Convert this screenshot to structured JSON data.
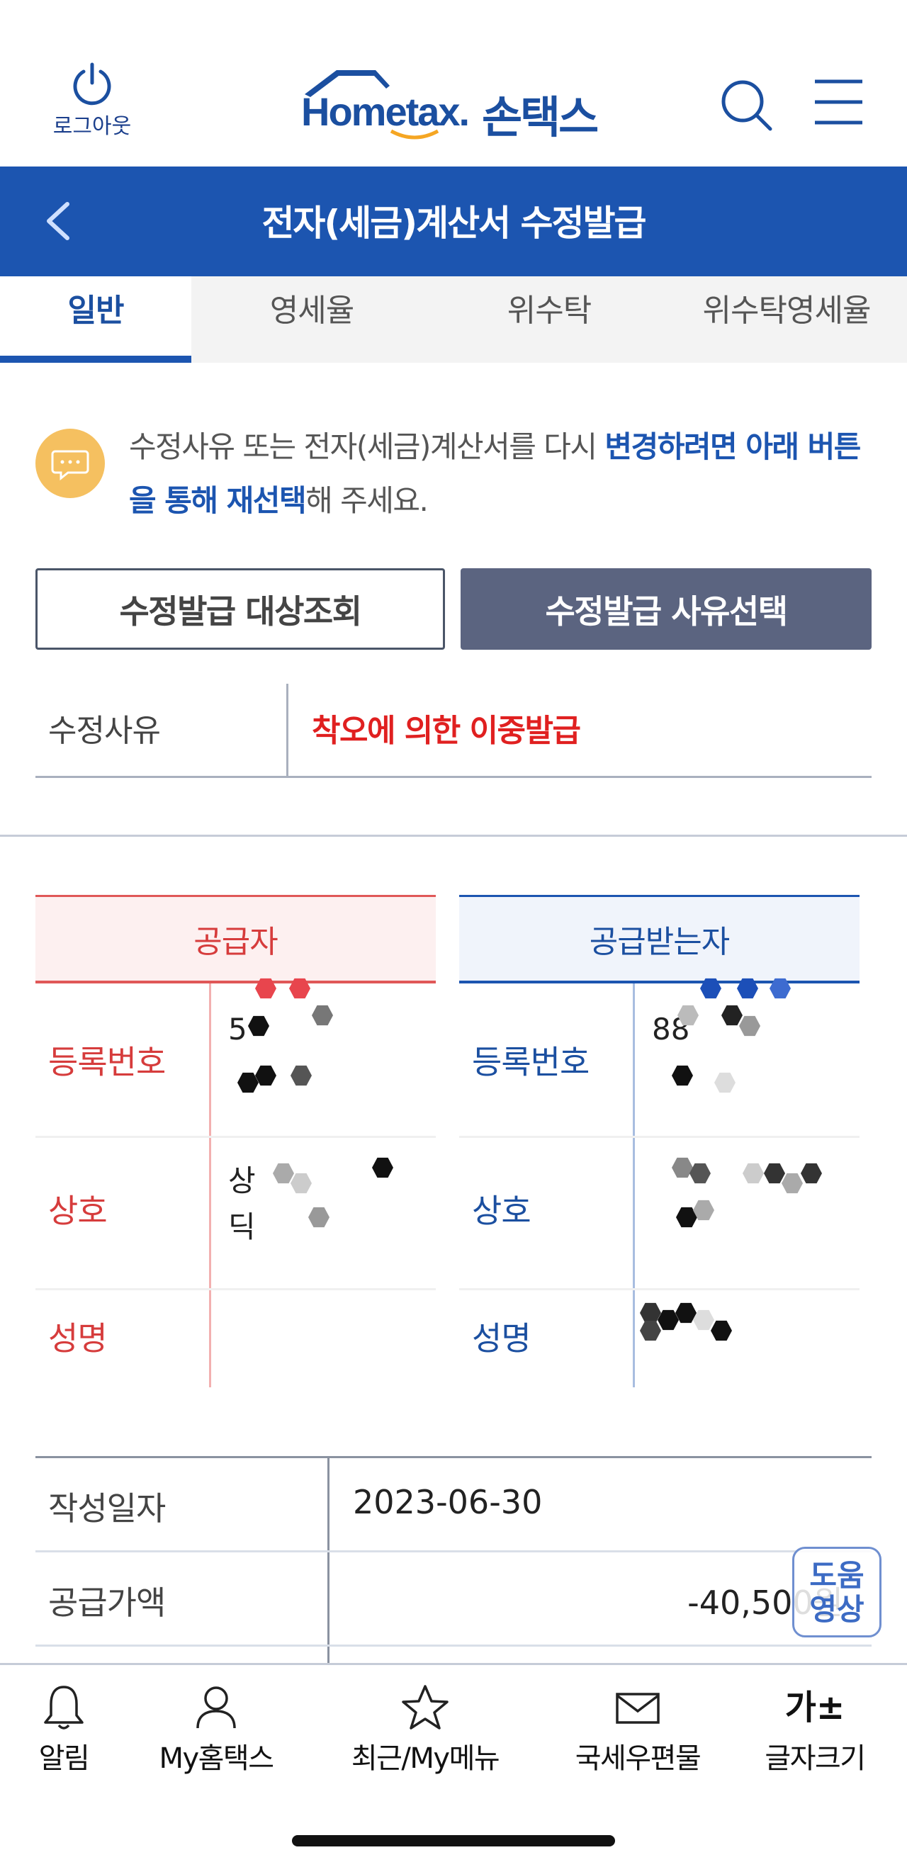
{
  "header": {
    "logout_label": "로그아웃",
    "logo_text": "Hometax.",
    "logo_korean": "손택스"
  },
  "titlebar": {
    "title": "전자(세금)계산서 수정발급"
  },
  "tabs": [
    {
      "label": "일반",
      "active": true
    },
    {
      "label": "영세율",
      "active": false
    },
    {
      "label": "위수탁",
      "active": false
    },
    {
      "label": "위수탁영세율",
      "active": false
    }
  ],
  "notice": {
    "text_normal_1": "수정사유 또는 전자(세금)계산서를 다시 ",
    "text_highlight": "변경하려면 아래 버튼을 통해 재선택",
    "text_normal_2": "해 주세요."
  },
  "buttons": {
    "lookup": "수정발급 대상조회",
    "select_reason": "수정발급 사유선택"
  },
  "reason": {
    "label": "수정사유",
    "value": "착오에 의한 이중발급"
  },
  "supplier": {
    "title": "공급자",
    "reg_label": "등록번호",
    "reg_value": "5",
    "name_label": "상호",
    "name_value_1": "상",
    "name_value_2": "딕",
    "rep_label": "성명",
    "rep_value": ""
  },
  "buyer": {
    "title": "공급받는자",
    "reg_label": "등록번호",
    "reg_value": "88",
    "name_label": "상호",
    "name_value_1": "",
    "name_value_2": "",
    "rep_label": "성명",
    "rep_value": ""
  },
  "info": {
    "date_label": "작성일자",
    "date_value": "2023-06-30",
    "amount_label": "공급가액",
    "amount_value": "-40,500원"
  },
  "help_button": {
    "line1": "도움",
    "line2": "영상"
  },
  "bottom_nav": [
    {
      "label": "알림",
      "icon": "bell-icon"
    },
    {
      "label": "My홈택스",
      "icon": "person-icon"
    },
    {
      "label": "최근/My메뉴",
      "icon": "star-icon"
    },
    {
      "label": "국세우편물",
      "icon": "mail-icon"
    },
    {
      "label": "글자크기",
      "icon": "font-size-icon",
      "glyph": "가±"
    }
  ],
  "colors": {
    "brand_blue": "#1c55b0",
    "reason_red": "#e02020",
    "supplier_red": "#d63c3c",
    "button_dark": "#5b6480"
  }
}
